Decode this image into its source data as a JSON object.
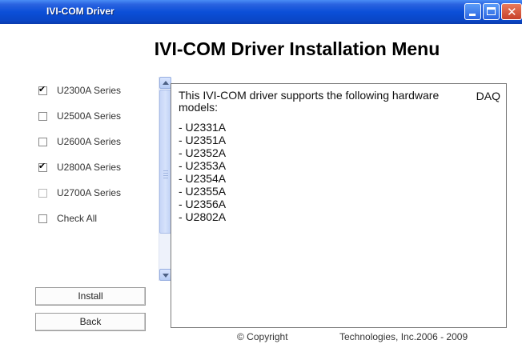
{
  "window": {
    "title": "IVI-COM Driver"
  },
  "heading": "IVI-COM Driver Installation Menu",
  "series": [
    {
      "label": "U2300A Series",
      "checked": true,
      "enabled": true
    },
    {
      "label": "U2500A Series",
      "checked": false,
      "enabled": true
    },
    {
      "label": "U2600A Series",
      "checked": false,
      "enabled": true
    },
    {
      "label": "U2800A Series",
      "checked": true,
      "enabled": true
    },
    {
      "label": "U2700A Series",
      "checked": false,
      "enabled": false
    },
    {
      "label": "Check All",
      "checked": false,
      "enabled": true
    }
  ],
  "description": {
    "text": "This IVI-COM driver supports the following hardware models:",
    "tag": "DAQ",
    "models": [
      "- U2331A",
      "- U2351A",
      "- U2352A",
      "- U2353A",
      "- U2354A",
      "- U2355A",
      "- U2356A",
      "- U2802A"
    ]
  },
  "buttons": {
    "install": "Install",
    "back": "Back"
  },
  "footer": {
    "copyright": "© Copyright",
    "company": "Technologies, Inc.2006 - 2009"
  }
}
